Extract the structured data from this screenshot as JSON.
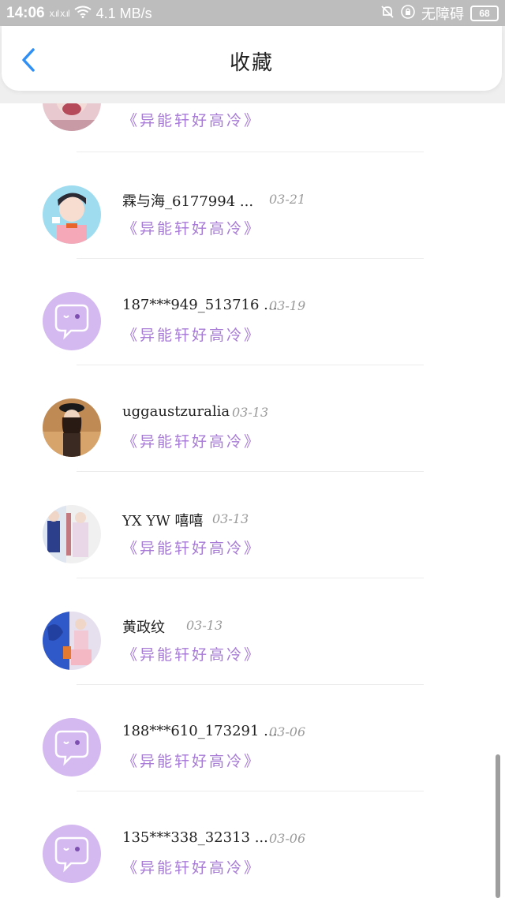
{
  "status_bar": {
    "time": "14:06",
    "signal_text": "x.ıl x.ıl",
    "speed": "4.1 MB/s",
    "carrier": "无障碍",
    "battery": "68"
  },
  "header": {
    "title": "收藏",
    "back_icon": "chevron-left-icon"
  },
  "colors": {
    "accent": "#2f8ff5",
    "title_purple": "#a77bd6",
    "bubble_purple": "#d4b8f0"
  },
  "items": [
    {
      "name": "",
      "date": "",
      "title": "《异能轩好高冷》",
      "avatar": "photo"
    },
    {
      "name": "霖与海_6177994 ...",
      "date": "03-21",
      "title": "《异能轩好高冷》",
      "avatar": "photo"
    },
    {
      "name": "187***949_513716 ...",
      "date": "03-19",
      "title": "《异能轩好高冷》",
      "avatar": "chat-bubble-icon"
    },
    {
      "name": "uggaustzuralia",
      "date": "03-13",
      "title": "《异能轩好高冷》",
      "avatar": "photo"
    },
    {
      "name": "YX YW 嘻嘻",
      "date": "03-13",
      "title": "《异能轩好高冷》",
      "avatar": "photo"
    },
    {
      "name": "黄政纹",
      "date": "03-13",
      "title": "《异能轩好高冷》",
      "avatar": "photo"
    },
    {
      "name": "188***610_173291 ...",
      "date": "03-06",
      "title": "《异能轩好高冷》",
      "avatar": "chat-bubble-icon"
    },
    {
      "name": "135***338_32313 ...",
      "date": "03-06",
      "title": "《异能轩好高冷》",
      "avatar": "chat-bubble-icon"
    }
  ]
}
